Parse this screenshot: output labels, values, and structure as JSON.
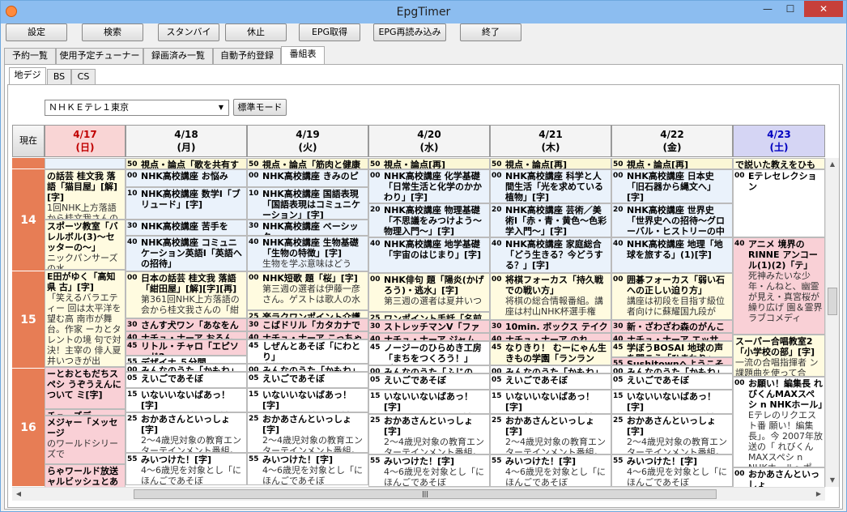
{
  "window": {
    "title": "EpgTimer",
    "min": "—",
    "max": "☐",
    "close": "✕"
  },
  "toolbar": [
    "設定",
    "検索",
    "スタンバイ",
    "休止",
    "EPG取得",
    "EPG再読み込み",
    "終了"
  ],
  "tabs": [
    "予約一覧",
    "使用予定チューナー",
    "録画済み一覧",
    "自動予約登録",
    "番組表"
  ],
  "subtabs": [
    "地デジ",
    "BS",
    "CS"
  ],
  "service_select": "ＮＨＫＥテレ１東京",
  "mode_button": "標準モード",
  "now_button": "現在",
  "days": [
    {
      "date": "4/17",
      "dow": "(日)",
      "color": "#c00000",
      "bg": "#f9d5d5"
    },
    {
      "date": "4/18",
      "dow": "(月)",
      "color": "#000000",
      "bg": "#f4f4f4"
    },
    {
      "date": "4/19",
      "dow": "(火)",
      "color": "#000000",
      "bg": "#f4f4f4"
    },
    {
      "date": "4/20",
      "dow": "(水)",
      "color": "#000000",
      "bg": "#f4f4f4"
    },
    {
      "date": "4/21",
      "dow": "(木)",
      "color": "#000000",
      "bg": "#f4f4f4"
    },
    {
      "date": "4/22",
      "dow": "(金)",
      "color": "#000000",
      "bg": "#f4f4f4"
    },
    {
      "date": "4/23",
      "dow": "(土)",
      "color": "#0000c0",
      "bg": "#d5d5f4"
    }
  ],
  "hours": [
    "14",
    "15",
    "16"
  ],
  "colors": {
    "accent": "#e77d55",
    "news": "#fbf7d6",
    "edu": "#eaf2fb",
    "anime": "#f9d0d6",
    "kids": "#ffffff",
    "hobby": "#fffbe0",
    "lesson": "#e8eef8"
  },
  "columns": [
    [
      {
        "m": "",
        "t": "",
        "d": "",
        "c": "edu",
        "h": 14
      },
      {
        "m": "",
        "t": "の話芸 桂文我 落語「猫目屋」[解][字]",
        "d": "1回NHK上方落語 から桂文我さんの「紺",
        "c": "hobby",
        "h": 62
      },
      {
        "m": "",
        "t": "スポーツ教室「バレルボル(3)〜セッターの〜」",
        "d": "ニックパンサーズの水",
        "c": "hobby",
        "h": 62
      },
      {
        "m": "",
        "t": "E田がゆく「高知県 古」[字]",
        "d": "「笑えるバラエティー 回は太平洋を望む高 南市が舞台。作家 ーカとタレントの境 句で対決！主宰の 俳人夏井いつきが出",
        "c": "hobby",
        "h": 120
      },
      {
        "m": "",
        "t": "ーとおともだちスペシ うぞうえんについて ミ[字]",
        "d": "",
        "c": "anime",
        "h": 52
      },
      {
        "m": "",
        "t": "チューズデー",
        "d": "",
        "c": "anime",
        "h": 8
      },
      {
        "m": "",
        "t": "メジャー「メッセージ",
        "d": "のワールドシリーズで",
        "c": "anime",
        "h": 60
      },
      {
        "m": "",
        "t": "らゃワールド放送 ャルビッシュとあそぼう",
        "d": "",
        "c": "anime",
        "h": 40
      }
    ],
    [
      {
        "m": "50",
        "t": "視点・論点「歌を共有する",
        "d": "",
        "c": "news",
        "h": 14
      },
      {
        "m": "00",
        "t": "NHK高校講座 お悩み",
        "d": "",
        "c": "edu",
        "h": 22
      },
      {
        "m": "10",
        "t": "NHK高校講座 数学Ⅰ「ブリュード」[字]",
        "d": "",
        "c": "edu",
        "h": 40
      },
      {
        "m": "30",
        "t": "NHK高校講座 苦手を",
        "d": "",
        "c": "edu",
        "h": 20
      },
      {
        "m": "40",
        "t": "NHK高校講座 コミュニケーション英語Ⅰ「英語への招待」",
        "d": "",
        "c": "edu",
        "h": 44
      },
      {
        "m": "00",
        "t": "日本の話芸 桂文我 落語「紺田屋」[解][字][再]",
        "d": "第361回NHK上方落語の会から桂文我さんの「紺",
        "c": "hobby",
        "h": 58
      },
      {
        "m": "30",
        "t": "さんす犬ワン「あなをん",
        "d": "",
        "c": "anime",
        "h": 16
      },
      {
        "m": "40",
        "t": "ナチュ・ナーア おるん",
        "d": "",
        "c": "anime",
        "h": 10
      },
      {
        "m": "45",
        "t": "リトル・チャロ「エピソード2",
        "d": "",
        "c": "anime",
        "h": 20
      },
      {
        "m": "55",
        "t": "デザイナ ５分間",
        "d": "",
        "c": "kids",
        "h": 10
      },
      {
        "m": "00",
        "t": "みんなのうた「かもね」",
        "d": "",
        "c": "kids",
        "h": 10
      },
      {
        "m": "05",
        "t": "えいごであそぼ",
        "d": "",
        "c": "kids",
        "h": 20
      },
      {
        "m": "15",
        "t": "いないいないばあっ！[字]",
        "d": "0歳児から2歳児を対象に",
        "c": "kids",
        "h": 30
      },
      {
        "m": "25",
        "t": "おかあさんといっしょ[字]",
        "d": "2〜4歳児対象の教育エンターテインメント番組。歌",
        "c": "kids",
        "h": 50
      },
      {
        "m": "55",
        "t": "みいつけた！[字]",
        "d": "4〜6歳児を対象とし「にほんごであそぼ",
        "c": "kids",
        "h": 40
      }
    ],
    [
      {
        "m": "50",
        "t": "視点・論点「筋肉と健康",
        "d": "",
        "c": "news",
        "h": 14
      },
      {
        "m": "00",
        "t": "NHK高校講座 きみのピ",
        "d": "",
        "c": "edu",
        "h": 22
      },
      {
        "m": "10",
        "t": "NHK高校講座 国語表現「国語表現はコミュニケーション」[字]",
        "d": "",
        "c": "edu",
        "h": 40
      },
      {
        "m": "30",
        "t": "NHK高校講座 ベーシック",
        "d": "",
        "c": "edu",
        "h": 20
      },
      {
        "m": "40",
        "t": "NHK高校講座 生物基礎「生物の特徴」[字]",
        "d": "生物を学ぶ意味はどう",
        "c": "edu",
        "h": 44
      },
      {
        "m": "00",
        "t": "NHK短歌 題「桜」[字]",
        "d": "第三週の選者は伊藤一彦さん。ゲストは歌人の水",
        "c": "hobby",
        "h": 48
      },
      {
        "m": "25",
        "t": "楽ラクワンポイント介護",
        "d": "",
        "c": "hobby",
        "h": 10
      },
      {
        "m": "30",
        "t": "こばドリル「カタカナで",
        "d": "",
        "c": "anime",
        "h": 16
      },
      {
        "m": "40",
        "t": "ナチュ・ナーア こっちゃ",
        "d": "",
        "c": "anime",
        "h": 10
      },
      {
        "m": "45",
        "t": "しぜんとあそぼ「にわとり」",
        "d": "自然と接し",
        "c": "kids",
        "h": 30
      },
      {
        "m": "00",
        "t": "みんなのうた「かもね」",
        "d": "",
        "c": "kids",
        "h": 10
      },
      {
        "m": "05",
        "t": "えいごであそぼ",
        "d": "",
        "c": "kids",
        "h": 20
      },
      {
        "m": "15",
        "t": "いないいないばあっ！[字]",
        "d": "0歳児から2歳児を対象に",
        "c": "kids",
        "h": 30
      },
      {
        "m": "25",
        "t": "おかあさんといっしょ[字]",
        "d": "2〜4歳児対象の教育エンターテインメント番組。歌",
        "c": "kids",
        "h": 50
      },
      {
        "m": "55",
        "t": "みいつけた！[字]",
        "d": "4〜6歳児を対象とし「にほんごであそぼ",
        "c": "kids",
        "h": 40
      }
    ],
    [
      {
        "m": "50",
        "t": "視点・論点[再]",
        "d": "",
        "c": "news",
        "h": 14
      },
      {
        "m": "00",
        "t": "NHK高校講座 化学基礎「日常生活と化学のかかわり」[字]",
        "d": "",
        "c": "edu",
        "h": 42
      },
      {
        "m": "20",
        "t": "NHK高校講座 物理基礎「不思議をみつけよう〜物理入門〜」[字]",
        "d": "",
        "c": "edu",
        "h": 42
      },
      {
        "m": "40",
        "t": "NHK高校講座 地学基礎「宇宙のはじまり」[字]",
        "d": "",
        "c": "edu",
        "h": 44
      },
      {
        "m": "00",
        "t": "NHK俳句 題「陽炎(かげろう)・逃水」[字]",
        "d": "第三週の選者は夏井いつ",
        "c": "hobby",
        "h": 48
      },
      {
        "m": "25",
        "t": "ワンポイント手話「名前",
        "d": "",
        "c": "hobby",
        "h": 10
      },
      {
        "m": "30",
        "t": "ストレッチマンV「ファイブ",
        "d": "",
        "c": "anime",
        "h": 16
      },
      {
        "m": "40",
        "t": "ナチュ・ナーア ジャム",
        "d": "",
        "c": "anime",
        "h": 10
      },
      {
        "m": "45",
        "t": "ノージーのひらめき工房「まちをつくろう！」[字]",
        "d": "",
        "c": "kids",
        "h": 30
      },
      {
        "m": "00",
        "t": "みんなのうた「ふじの",
        "d": "",
        "c": "kids",
        "h": 10
      },
      {
        "m": "05",
        "t": "えいごであそぼ",
        "d": "",
        "c": "kids",
        "h": 20
      },
      {
        "m": "15",
        "t": "いないいないばあっ！[字]",
        "d": "0歳児から2歳児を対象に",
        "c": "kids",
        "h": 30
      },
      {
        "m": "25",
        "t": "おかあさんといっしょ[字]",
        "d": "2〜4歳児対象の教育エンターテインメント番組。歌",
        "c": "kids",
        "h": 50
      },
      {
        "m": "55",
        "t": "みいつけた！[字]",
        "d": "4〜6歳児を対象とし「にほんごであそぼ",
        "c": "kids",
        "h": 40
      }
    ],
    [
      {
        "m": "50",
        "t": "視点・論点[再]",
        "d": "",
        "c": "news",
        "h": 14
      },
      {
        "m": "00",
        "t": "NHK高校講座 科学と人間生活「光を求めている植物」[字]",
        "d": "",
        "c": "edu",
        "h": 42
      },
      {
        "m": "20",
        "t": "NHK高校講座 芸術／美術Ⅰ「赤・青・黄色〜色彩学入門〜」[字]",
        "d": "",
        "c": "edu",
        "h": 42
      },
      {
        "m": "40",
        "t": "NHK高校講座 家庭総合「どう生きる？今どうする？」[字]",
        "d": "",
        "c": "edu",
        "h": 44
      },
      {
        "m": "00",
        "t": "将棋フォーカス「持久戦での戦い方」",
        "d": "将棋の総合情報番組。講座は村山NHK杯選手権",
        "c": "hobby",
        "h": 58
      },
      {
        "m": "30",
        "t": "10min. ボックス テイク",
        "d": "",
        "c": "anime",
        "h": 16
      },
      {
        "m": "40",
        "t": "ナチュ・ナーア のれ",
        "d": "",
        "c": "anime",
        "h": 10
      },
      {
        "m": "45",
        "t": "なりきり！ むーにゃん生きもの学園「ランラン卵！？",
        "d": "",
        "c": "hobby",
        "h": 30
      },
      {
        "m": "00",
        "t": "みんなのうた「かもね」",
        "d": "",
        "c": "kids",
        "h": 10
      },
      {
        "m": "05",
        "t": "えいごであそぼ",
        "d": "",
        "c": "kids",
        "h": 20
      },
      {
        "m": "15",
        "t": "いないいないばあっ！[字]",
        "d": "0歳児から2歳児を対象に",
        "c": "kids",
        "h": 30
      },
      {
        "m": "25",
        "t": "おかあさんといっしょ[字]",
        "d": "2〜4歳児対象の教育エンターテインメント番組。歌",
        "c": "kids",
        "h": 50
      },
      {
        "m": "55",
        "t": "みいつけた！[字]",
        "d": "4〜6歳児を対象とし「にほんごであそぼ",
        "c": "kids",
        "h": 40
      }
    ],
    [
      {
        "m": "50",
        "t": "視点・論点[再]",
        "d": "",
        "c": "news",
        "h": 14
      },
      {
        "m": "00",
        "t": "NHK高校講座 日本史「旧石器から縄文へ」[字]",
        "d": "",
        "c": "edu",
        "h": 42
      },
      {
        "m": "20",
        "t": "NHK高校講座 世界史「世界史への招待〜グローバル・ヒストリーの中の現",
        "d": "",
        "c": "edu",
        "h": 42
      },
      {
        "m": "40",
        "t": "NHK高校講座 地理「地球を旅する」(1)[字]",
        "d": "",
        "c": "edu",
        "h": 44
      },
      {
        "m": "00",
        "t": "囲碁フォーカス「弱い石への正しい迫り方」",
        "d": "講座は初段を目指す級位者向けに蘇耀国九段が",
        "c": "hobby",
        "h": 58
      },
      {
        "m": "30",
        "t": "新・ざわざわ森のがんこちゃん",
        "d": "",
        "c": "anime",
        "h": 16
      },
      {
        "m": "40",
        "t": "ナチュ・ナーア エッサ",
        "d": "",
        "c": "anime",
        "h": 10
      },
      {
        "m": "45",
        "t": "学ぼうBOSAI 地球の声を聞こう「ひまわり」",
        "d": "",
        "c": "hobby",
        "h": 20
      },
      {
        "m": "55",
        "t": "Sushitownへようこそ",
        "d": "",
        "c": "anime",
        "h": 10
      },
      {
        "m": "00",
        "t": "みんなのうた「かもね」",
        "d": "",
        "c": "kids",
        "h": 10
      },
      {
        "m": "05",
        "t": "えいごであそぼ",
        "d": "",
        "c": "kids",
        "h": 20
      },
      {
        "m": "15",
        "t": "いないいないばあっ！[字]",
        "d": "0歳児から2歳児を対象に",
        "c": "kids",
        "h": 30
      },
      {
        "m": "25",
        "t": "おかあさんといっしょ[字]",
        "d": "2〜4歳児対象の教育エンターテインメント番組。歌",
        "c": "kids",
        "h": 50
      },
      {
        "m": "55",
        "t": "みいつけた！[字]",
        "d": "4〜6歳児を対象とし「にほんごであそぼ",
        "c": "kids",
        "h": 40
      }
    ],
    [
      {
        "m": "",
        "t": "で説いた教えをひも",
        "d": "",
        "c": "hobby",
        "h": 14
      },
      {
        "m": "00",
        "t": "Eテレセレクション",
        "d": "",
        "c": "kids",
        "h": 84
      },
      {
        "m": "40",
        "t": "アニメ 境界のRINNE アンコール(1)(2)「テ」",
        "d": "死神みたいな少年・んねと、幽霊が見え・真宮桜が繰り広げ 園＆霊界ラブコメディ",
        "c": "anime",
        "h": 120
      },
      {
        "m": "",
        "t": "スーパー合唱教室2「小学校の部」[字]",
        "d": "一流の合唱指揮者 ン課題曲を使って合",
        "c": "hobby",
        "h": 52
      },
      {
        "m": "00",
        "t": "お願い！編集長 れびくんMAXスペシ n NHKホール」",
        "d": "Eテレのリクエスト番 願い！編集長」。今 2007年放送の「 れびくんMAXスペシ n NHKホール〜ポ",
        "c": "kids",
        "h": 112
      },
      {
        "m": "00",
        "t": "おかあさんといっしょ",
        "d": "2〜4歳児対象の",
        "c": "kids",
        "h": 40
      }
    ]
  ]
}
